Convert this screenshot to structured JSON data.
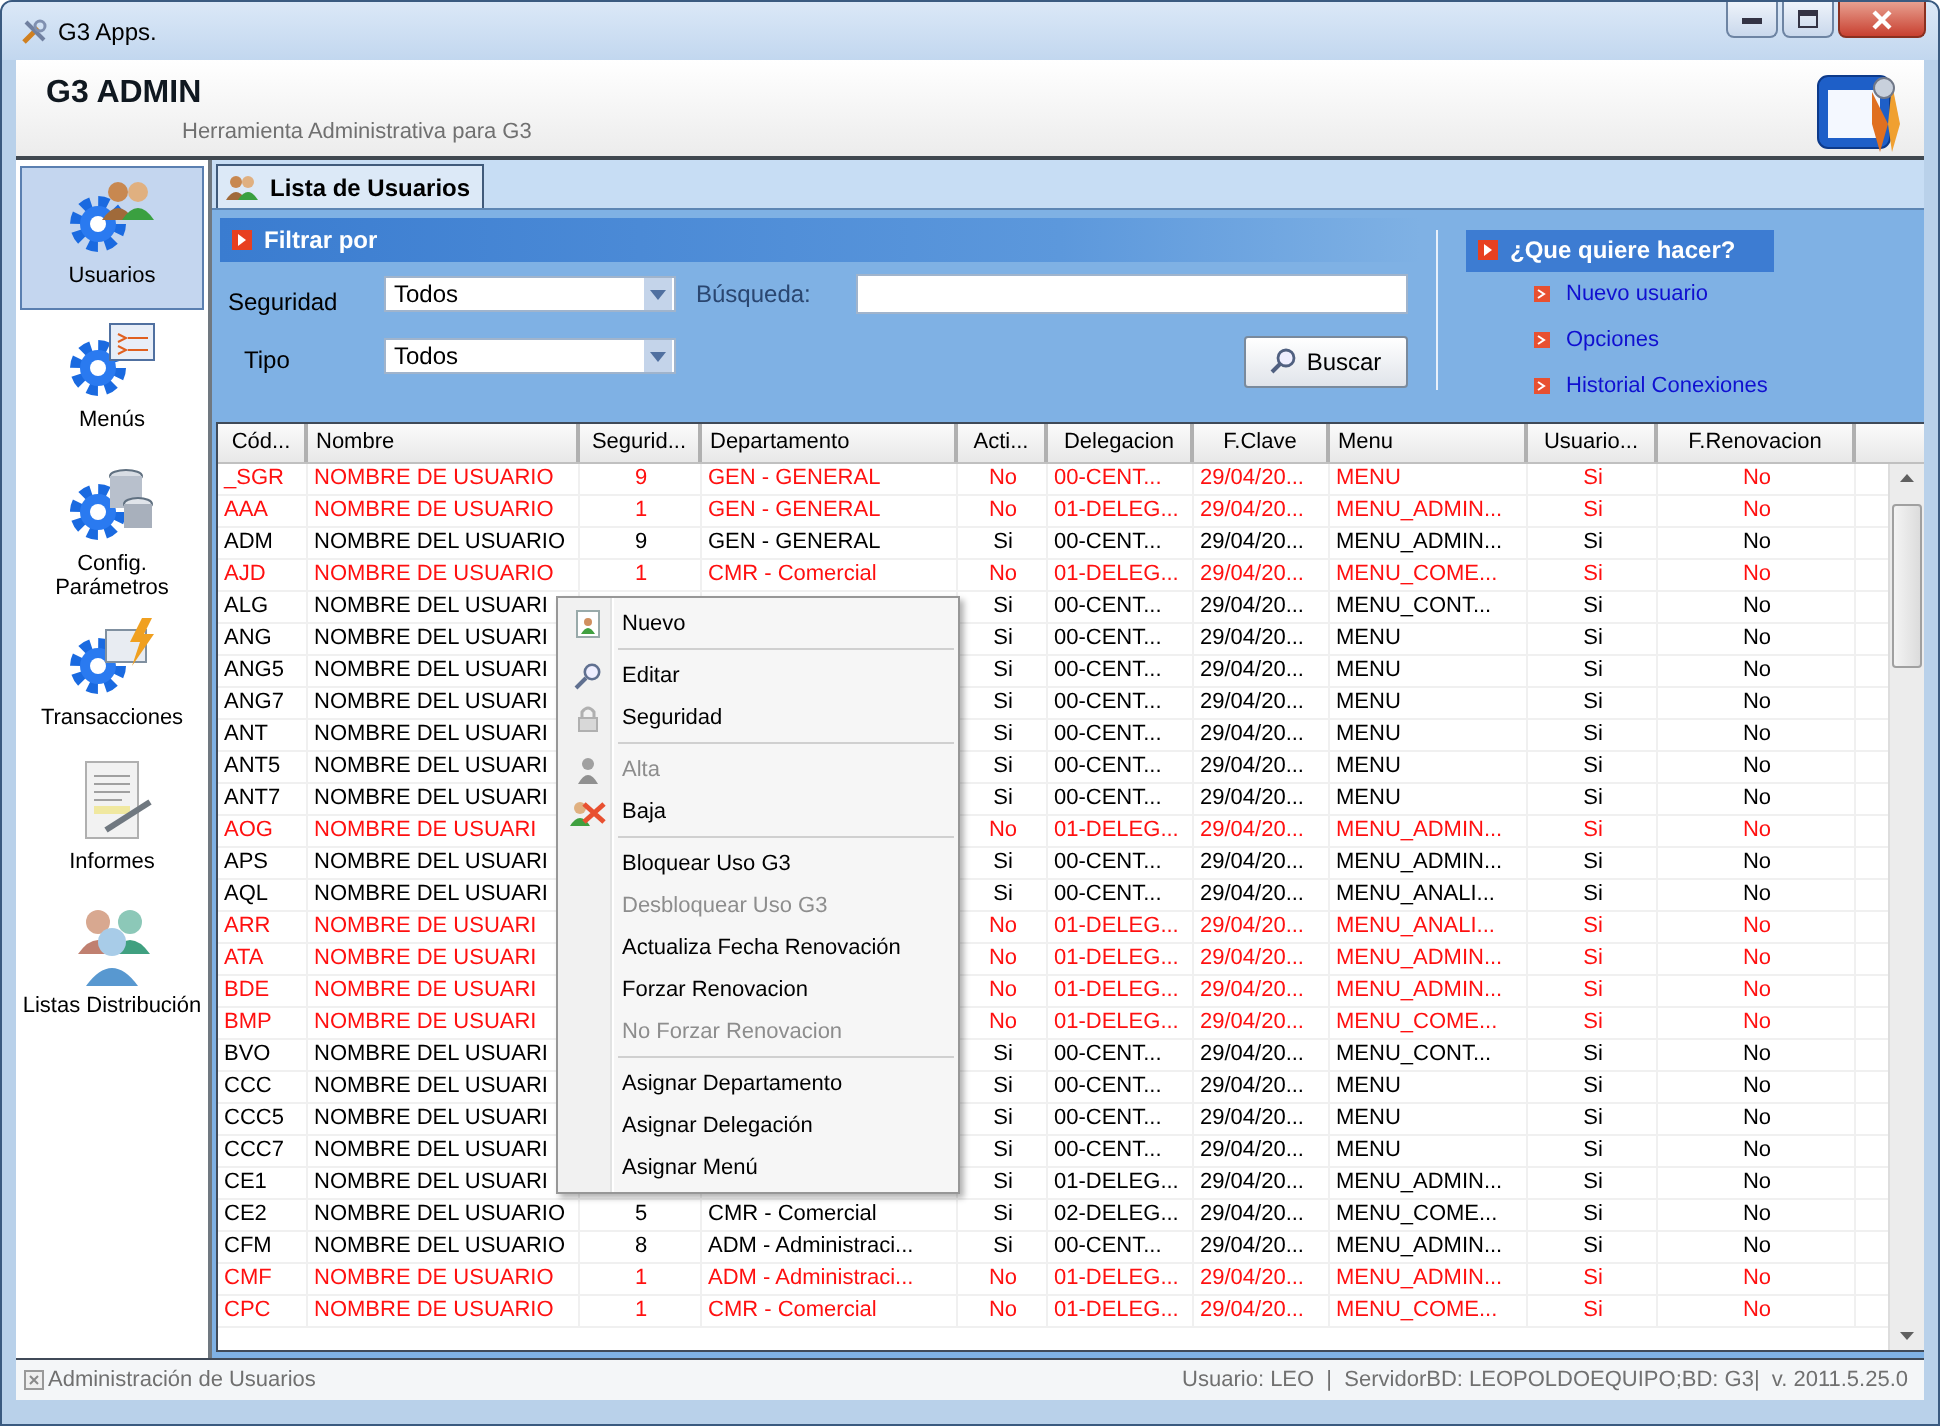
{
  "window": {
    "title": "G3 Apps."
  },
  "header": {
    "title": "G3 ADMIN",
    "subtitle": "Herramienta Administrativa para G3"
  },
  "sidebar": {
    "items": [
      {
        "label": "Usuarios",
        "selected": true
      },
      {
        "label": "Menús",
        "selected": false
      },
      {
        "label": "Config. Parámetros",
        "selected": false
      },
      {
        "label": "Transacciones",
        "selected": false
      },
      {
        "label": "Informes",
        "selected": false
      },
      {
        "label": "Listas Distribución",
        "selected": false
      }
    ]
  },
  "tabs": [
    {
      "label": "Lista de Usuarios",
      "selected": true
    }
  ],
  "filter": {
    "title": "Filtrar por",
    "seguridad_label": "Seguridad",
    "seguridad_value": "Todos",
    "busqueda_label": "Búsqueda:",
    "tipo_label": "Tipo",
    "tipo_value": "Todos",
    "search_button": "Buscar"
  },
  "actions": {
    "title": "¿Que quiere hacer?",
    "links": [
      "Nuevo usuario",
      "Opciones",
      "Historial Conexiones"
    ]
  },
  "table": {
    "columns": [
      "Cód...",
      "Nombre",
      "Segurid...",
      "Departamento",
      "Acti...",
      "Delegacion",
      "F.Clave",
      "Menu",
      "Usuario...",
      "F.Renovacion"
    ],
    "rows": [
      {
        "inactive": true,
        "cells": [
          "_SGR",
          "NOMBRE DE USUARIO",
          "9",
          "GEN - GENERAL",
          "No",
          "00-CENT...",
          "29/04/20...",
          "MENU",
          "Si",
          "No"
        ]
      },
      {
        "inactive": true,
        "cells": [
          "AAA",
          "NOMBRE DE USUARIO",
          "1",
          "GEN - GENERAL",
          "No",
          "01-DELEG...",
          "29/04/20...",
          "MENU_ADMIN...",
          "Si",
          "No"
        ]
      },
      {
        "inactive": false,
        "cells": [
          "ADM",
          "NOMBRE DEL USUARIO",
          "9",
          "GEN - GENERAL",
          "Si",
          "00-CENT...",
          "29/04/20...",
          "MENU_ADMIN...",
          "Si",
          "No"
        ]
      },
      {
        "inactive": true,
        "cells": [
          "AJD",
          "NOMBRE DE USUARIO",
          "1",
          "CMR - Comercial",
          "No",
          "01-DELEG...",
          "29/04/20...",
          "MENU_COME...",
          "Si",
          "No"
        ]
      },
      {
        "inactive": false,
        "cells": [
          "ALG",
          "NOMBRE DEL USUARI",
          null,
          null,
          "Si",
          "00-CENT...",
          "29/04/20...",
          "MENU_CONT...",
          "Si",
          "No"
        ]
      },
      {
        "inactive": false,
        "cells": [
          "ANG",
          "NOMBRE DEL USUARI",
          null,
          null,
          "Si",
          "00-CENT...",
          "29/04/20...",
          "MENU",
          "Si",
          "No"
        ]
      },
      {
        "inactive": false,
        "cells": [
          "ANG5",
          "NOMBRE DEL USUARI",
          null,
          null,
          "Si",
          "00-CENT...",
          "29/04/20...",
          "MENU",
          "Si",
          "No"
        ]
      },
      {
        "inactive": false,
        "cells": [
          "ANG7",
          "NOMBRE DEL USUARI",
          null,
          null,
          "Si",
          "00-CENT...",
          "29/04/20...",
          "MENU",
          "Si",
          "No"
        ]
      },
      {
        "inactive": false,
        "cells": [
          "ANT",
          "NOMBRE DEL USUARI",
          null,
          null,
          "Si",
          "00-CENT...",
          "29/04/20...",
          "MENU",
          "Si",
          "No"
        ]
      },
      {
        "inactive": false,
        "cells": [
          "ANT5",
          "NOMBRE DEL USUARI",
          null,
          null,
          "Si",
          "00-CENT...",
          "29/04/20...",
          "MENU",
          "Si",
          "No"
        ]
      },
      {
        "inactive": false,
        "cells": [
          "ANT7",
          "NOMBRE DEL USUARI",
          null,
          null,
          "Si",
          "00-CENT...",
          "29/04/20...",
          "MENU",
          "Si",
          "No"
        ]
      },
      {
        "inactive": true,
        "cells": [
          "AOG",
          "NOMBRE DE USUARI",
          null,
          null,
          "No",
          "01-DELEG...",
          "29/04/20...",
          "MENU_ADMIN...",
          "Si",
          "No"
        ]
      },
      {
        "inactive": false,
        "cells": [
          "APS",
          "NOMBRE DEL USUARI",
          null,
          null,
          "Si",
          "00-CENT...",
          "29/04/20...",
          "MENU_ADMIN...",
          "Si",
          "No"
        ]
      },
      {
        "inactive": false,
        "cells": [
          "AQL",
          "NOMBRE DEL USUARI",
          null,
          null,
          "Si",
          "00-CENT...",
          "29/04/20...",
          "MENU_ANALI...",
          "Si",
          "No"
        ]
      },
      {
        "inactive": true,
        "cells": [
          "ARR",
          "NOMBRE DE USUARI",
          null,
          null,
          "No",
          "01-DELEG...",
          "29/04/20...",
          "MENU_ANALI...",
          "Si",
          "No"
        ]
      },
      {
        "inactive": true,
        "cells": [
          "ATA",
          "NOMBRE DE USUARI",
          null,
          null,
          "No",
          "01-DELEG...",
          "29/04/20...",
          "MENU_ADMIN...",
          "Si",
          "No"
        ]
      },
      {
        "inactive": true,
        "cells": [
          "BDE",
          "NOMBRE DE USUARI",
          null,
          null,
          "No",
          "01-DELEG...",
          "29/04/20...",
          "MENU_ADMIN...",
          "Si",
          "No"
        ]
      },
      {
        "inactive": true,
        "cells": [
          "BMP",
          "NOMBRE DE USUARI",
          null,
          null,
          "No",
          "01-DELEG...",
          "29/04/20...",
          "MENU_COME...",
          "Si",
          "No"
        ]
      },
      {
        "inactive": false,
        "cells": [
          "BVO",
          "NOMBRE DEL USUARI",
          null,
          null,
          "Si",
          "00-CENT...",
          "29/04/20...",
          "MENU_CONT...",
          "Si",
          "No"
        ]
      },
      {
        "inactive": false,
        "cells": [
          "CCC",
          "NOMBRE DEL USUARI",
          null,
          null,
          "Si",
          "00-CENT...",
          "29/04/20...",
          "MENU",
          "Si",
          "No"
        ]
      },
      {
        "inactive": false,
        "cells": [
          "CCC5",
          "NOMBRE DEL USUARI",
          null,
          null,
          "Si",
          "00-CENT...",
          "29/04/20...",
          "MENU",
          "Si",
          "No"
        ]
      },
      {
        "inactive": false,
        "cells": [
          "CCC7",
          "NOMBRE DEL USUARI",
          null,
          null,
          "Si",
          "00-CENT...",
          "29/04/20...",
          "MENU",
          "Si",
          "No"
        ]
      },
      {
        "inactive": false,
        "cells": [
          "CE1",
          "NOMBRE DEL USUARI",
          null,
          null,
          "Si",
          "01-DELEG...",
          "29/04/20...",
          "MENU_ADMIN...",
          "Si",
          "No"
        ]
      },
      {
        "inactive": false,
        "cells": [
          "CE2",
          "NOMBRE DEL USUARIO",
          "5",
          "CMR - Comercial",
          "Si",
          "02-DELEG...",
          "29/04/20...",
          "MENU_COME...",
          "Si",
          "No"
        ]
      },
      {
        "inactive": false,
        "cells": [
          "CFM",
          "NOMBRE DEL USUARIO",
          "8",
          "ADM - Administraci...",
          "Si",
          "00-CENT...",
          "29/04/20...",
          "MENU_ADMIN...",
          "Si",
          "No"
        ]
      },
      {
        "inactive": true,
        "cells": [
          "CMF",
          "NOMBRE DE USUARIO",
          "1",
          "ADM - Administraci...",
          "No",
          "01-DELEG...",
          "29/04/20...",
          "MENU_ADMIN...",
          "Si",
          "No"
        ]
      },
      {
        "inactive": true,
        "cells": [
          "CPC",
          "NOMBRE DE USUARIO",
          "1",
          "CMR - Comercial",
          "No",
          "01-DELEG...",
          "29/04/20...",
          "MENU_COME...",
          "Si",
          "No"
        ]
      }
    ]
  },
  "context_menu": {
    "items": [
      {
        "kind": "item",
        "label": "Nuevo",
        "disabled": false
      },
      {
        "kind": "separator"
      },
      {
        "kind": "item",
        "label": "Editar",
        "disabled": false
      },
      {
        "kind": "item",
        "label": "Seguridad",
        "disabled": false
      },
      {
        "kind": "separator"
      },
      {
        "kind": "item",
        "label": "Alta",
        "disabled": true
      },
      {
        "kind": "item",
        "label": "Baja",
        "disabled": false
      },
      {
        "kind": "separator"
      },
      {
        "kind": "item",
        "label": "Bloquear Uso G3",
        "disabled": false
      },
      {
        "kind": "item",
        "label": "Desbloquear Uso G3",
        "disabled": true
      },
      {
        "kind": "item",
        "label": "Actualiza Fecha Renovación",
        "disabled": false
      },
      {
        "kind": "item",
        "label": "Forzar Renovacion",
        "disabled": false
      },
      {
        "kind": "item",
        "label": "No Forzar Renovacion",
        "disabled": true
      },
      {
        "kind": "separator"
      },
      {
        "kind": "item",
        "label": "Asignar Departamento",
        "disabled": false
      },
      {
        "kind": "item",
        "label": "Asignar Delegación",
        "disabled": false
      },
      {
        "kind": "item",
        "label": "Asignar Menú",
        "disabled": false
      }
    ]
  },
  "status_bar": {
    "left": "Administración de Usuarios",
    "right": "Usuario: LEO  |  ServidorBD: LEOPOLDOEQUIPO;BD: G3|  v. 2011.5.25.0"
  }
}
